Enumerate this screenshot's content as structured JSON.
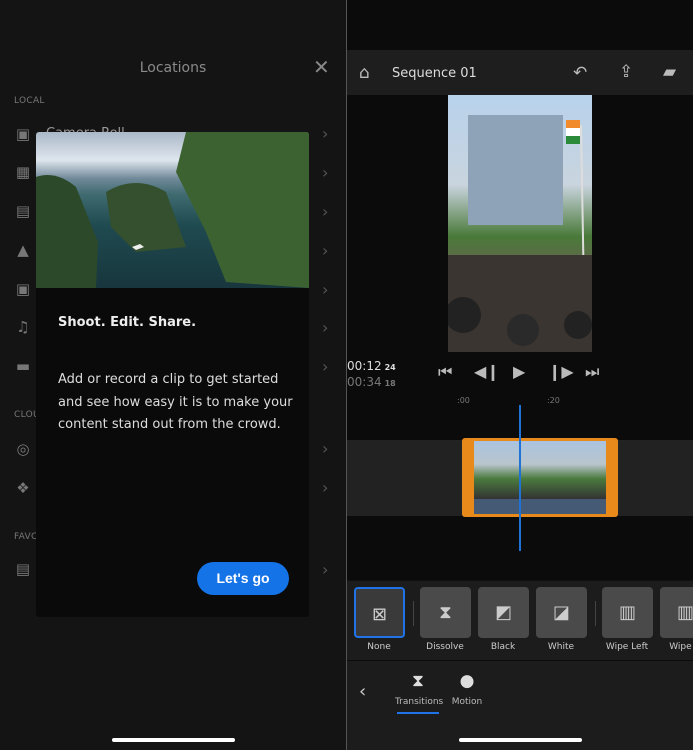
{
  "left": {
    "title": "Locations",
    "close_icon": "close-icon",
    "sections": {
      "local": "LOCAL",
      "cloud": "CLOU",
      "favorites": "FAVC"
    },
    "first_item_label": "Camera Roll",
    "modal": {
      "title": "Shoot. Edit. Share.",
      "body": "Add or record a clip to get started and see how easy it is to make your content stand out from the crowd.",
      "button": "Let's go"
    }
  },
  "right": {
    "header": {
      "title": "Sequence 01"
    },
    "timecode": {
      "current": "00:12",
      "current_frames": "24",
      "total": "00:34",
      "total_frames": "18"
    },
    "ruler": [
      ":00",
      ":20"
    ],
    "transitions": [
      {
        "label": "None",
        "selected": true
      },
      {
        "label": "Dissolve"
      },
      {
        "label": "Black"
      },
      {
        "label": "White"
      },
      {
        "label": "Wipe Left"
      },
      {
        "label": "Wipe R"
      }
    ],
    "tabs": [
      {
        "label": "Transitions",
        "active": true
      },
      {
        "label": "Motion"
      }
    ],
    "accent": "#1473e6",
    "clip_color": "#e8891c"
  }
}
